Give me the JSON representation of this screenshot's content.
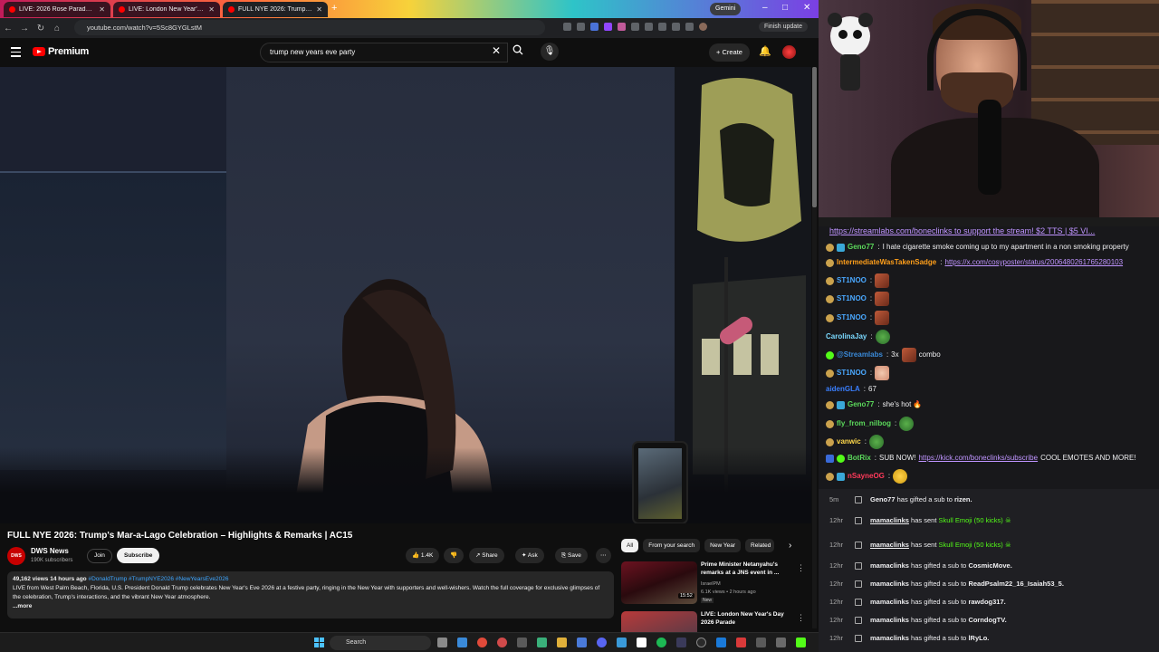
{
  "browser": {
    "tabs": [
      {
        "label": "LIVE: 2026 Rose Parade under"
      },
      {
        "label": "LIVE: London New Year's Day 2"
      },
      {
        "label": "FULL NYE 2026: Trump's M"
      }
    ],
    "gemini_label": "Gemini",
    "url": "youtube.com/watch?v=5Sc8GYGLstM",
    "finish_update": "Finish update"
  },
  "youtube": {
    "logo_text": "Premium",
    "search_value": "trump new years eve party",
    "create_label": "Create",
    "video_title": "FULL NYE 2026: Trump's Mar-a-Lago Celebration – Highlights & Remarks | AC15",
    "channel_name": "DWS News",
    "channel_subs": "190K subscribers",
    "channel_avatar_text": "DWS",
    "join_label": "Join",
    "subscribe_label": "Subscribe",
    "like_count": "1.4K",
    "share_label": "Share",
    "ask_label": "Ask",
    "save_label": "Save",
    "desc_stats": "49,162 views  14 hours ago",
    "desc_tags": "#DonaldTrump #TrumpNYE2026 #NewYearsEve2026",
    "desc_text": "LIVE from West Palm Beach, Florida, U.S. President Donald Trump celebrates New Year's Eve 2026 at a festive party, ringing in the New Year with supporters and well-wishers. Watch the full coverage for exclusive glimpses of the celebration, Trump's interactions, and the vibrant New Year atmosphere.",
    "desc_more": "...more",
    "chips": [
      "All",
      "From your search",
      "New Year",
      "Related"
    ],
    "recs": [
      {
        "title": "Prime Minister Netanyahu's remarks at a JNS event in ...",
        "channel": "IsraelPM",
        "meta": "6.1K views • 2 hours ago",
        "badge": "New",
        "duration": "15:52"
      },
      {
        "title": "LIVE: London New Year's Day 2026 Parade",
        "channel": "",
        "meta": "",
        "badge": "",
        "duration": ""
      }
    ]
  },
  "chat": {
    "top_text": "https://streamlabs.com/boneclinks to support the stream! $2 TTS | $5 VI...",
    "lines": [
      {
        "user": "Geno77",
        "color": "#5bd95b",
        "text": "I hate cigarette smoke coming up to my apartment in a non smoking property"
      },
      {
        "user": "IntermediateWasTakenSadge",
        "color": "#ff9f1a",
        "link": "https://x.com/cosyposter/status/2006480261765280103"
      },
      {
        "user": "ST1NOO",
        "color": "#4aa8ff"
      },
      {
        "user": "ST1NOO",
        "color": "#4aa8ff"
      },
      {
        "user": "ST1NOO",
        "color": "#4aa8ff"
      },
      {
        "user": "CarolinaJay",
        "color": "#7ad9ff"
      },
      {
        "user": "@Streamlabs",
        "color": "#3a8ad9",
        "text": "3x",
        "text2": "combo"
      },
      {
        "user": "ST1NOO",
        "color": "#4aa8ff"
      },
      {
        "user": "aidenGLA",
        "color": "#3a7fff",
        "text": "67"
      },
      {
        "user": "Geno77",
        "color": "#5bd95b",
        "text": "she's hot"
      },
      {
        "user": "fly_from_nilbog",
        "color": "#5bd95b"
      },
      {
        "user": "vanwic",
        "color": "#ffd84a"
      },
      {
        "user": "BotRix",
        "color": "#5bd95b",
        "text": "SUB NOW!",
        "link": "https://kick.com/boneclinks/subscribe",
        "text2": "COOL EMOTES AND MORE!"
      },
      {
        "user": "nSayneOG",
        "color": "#ff3a5a"
      }
    ]
  },
  "events": [
    {
      "time": "5m",
      "user": "Geno77",
      "text": "has gifted a sub to",
      "target": "rizen."
    },
    {
      "time": "12hr",
      "user": "mamaclinks",
      "text": "has sent",
      "target": "Skull Emoji (50 kicks)"
    },
    {
      "time": "12hr",
      "user": "mamaclinks",
      "text": "has sent",
      "target": "Skull Emoji (50 kicks)"
    },
    {
      "time": "12hr",
      "user": "mamaclinks",
      "text": "has gifted a sub to",
      "target": "CosmicMove."
    },
    {
      "time": "12hr",
      "user": "mamaclinks",
      "text": "has gifted a sub to",
      "target": "ReadPsalm22_16_Isaiah53_5."
    },
    {
      "time": "12hr",
      "user": "mamaclinks",
      "text": "has gifted a sub to",
      "target": "rawdog317."
    },
    {
      "time": "12hr",
      "user": "mamaclinks",
      "text": "has gifted a sub to",
      "target": "CorndogTV."
    },
    {
      "time": "12hr",
      "user": "mamaclinks",
      "text": "has gifted a sub to",
      "target": "lRyLo."
    }
  ],
  "taskbar": {
    "search_label": "Search"
  }
}
